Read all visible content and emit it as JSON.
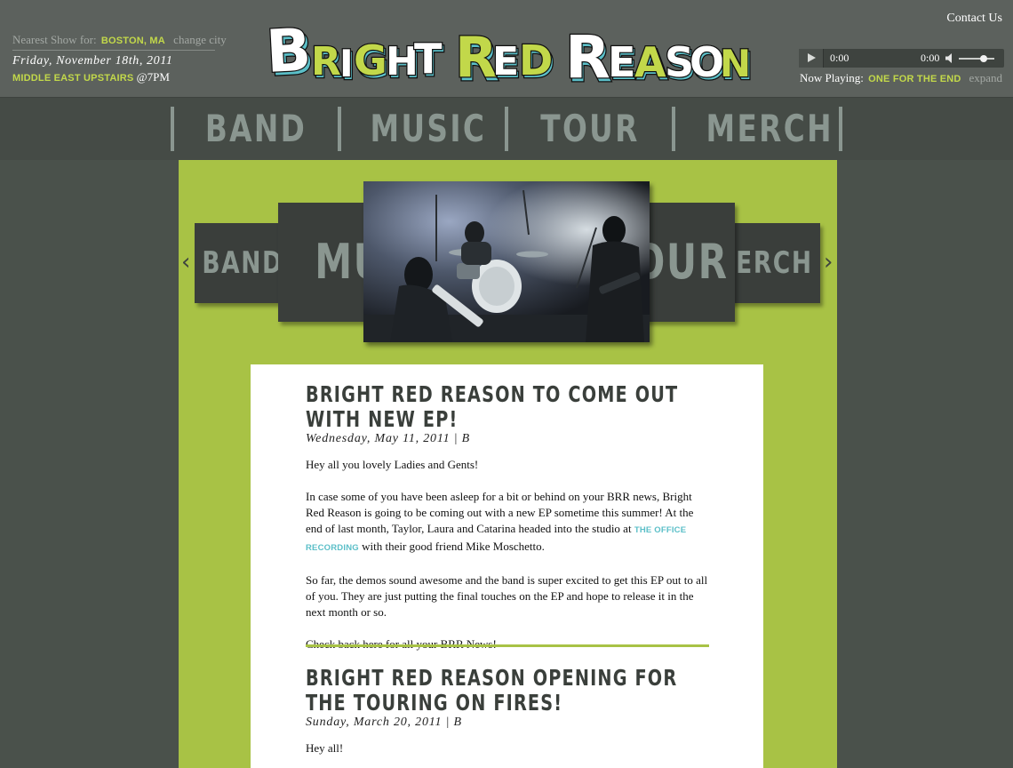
{
  "header": {
    "nearest_label": "Nearest Show for:",
    "nearest_city": "BOSTON, MA",
    "change_city": "change city",
    "show_date": "Friday, November 18th, 2011",
    "show_venue": "MIDDLE EAST UPSTAIRS",
    "show_time": "@7PM",
    "logo_text": "BRIGHT RED REASON",
    "contact": "Contact Us"
  },
  "player": {
    "elapsed": "0:00",
    "total": "0:00",
    "now_playing_label": "Now Playing:",
    "track": "ONE FOR THE END",
    "expand": "expand",
    "volume_level": 0.7
  },
  "nav": {
    "items": [
      "BAND",
      "MUSIC",
      "TOUR",
      "MERCH"
    ]
  },
  "carousel": {
    "slides": [
      "BAND",
      "MUSIC",
      "TOUR",
      "MERCH"
    ],
    "prev": "‹",
    "next": "›"
  },
  "posts": [
    {
      "title": "BRIGHT RED REASON TO COME OUT WITH NEW EP!",
      "meta": "Wednesday, May 11, 2011 | B",
      "p1": "Hey all you lovely Ladies and Gents!",
      "p2_before": "In case some of you have been asleep for a bit or behind on your BRR news, Bright Red Reason is going to be coming out with a new EP sometime this summer! At the end of last month, Taylor, Laura and Catarina headed into the studio at ",
      "p2_link": "THE OFFICE RECORDING",
      "p2_after": " with their good friend Mike Moschetto.",
      "p3": "So far, the demos sound awesome and the band is super excited to get this EP out to all of you. They are just putting the final touches on the EP and hope to release it in the next month or so.",
      "p4": "Check back here for all your BRR News!"
    },
    {
      "title": "BRIGHT RED REASON OPENING FOR THE TOURING ON FIRES!",
      "meta": "Sunday, March 20, 2011 | B",
      "p1": "Hey all!"
    }
  ],
  "colors": {
    "accent_green": "#a8c245",
    "accent_cyan": "#5bbfc8",
    "background": "#4a514b",
    "header_bg": "#5c615d"
  }
}
